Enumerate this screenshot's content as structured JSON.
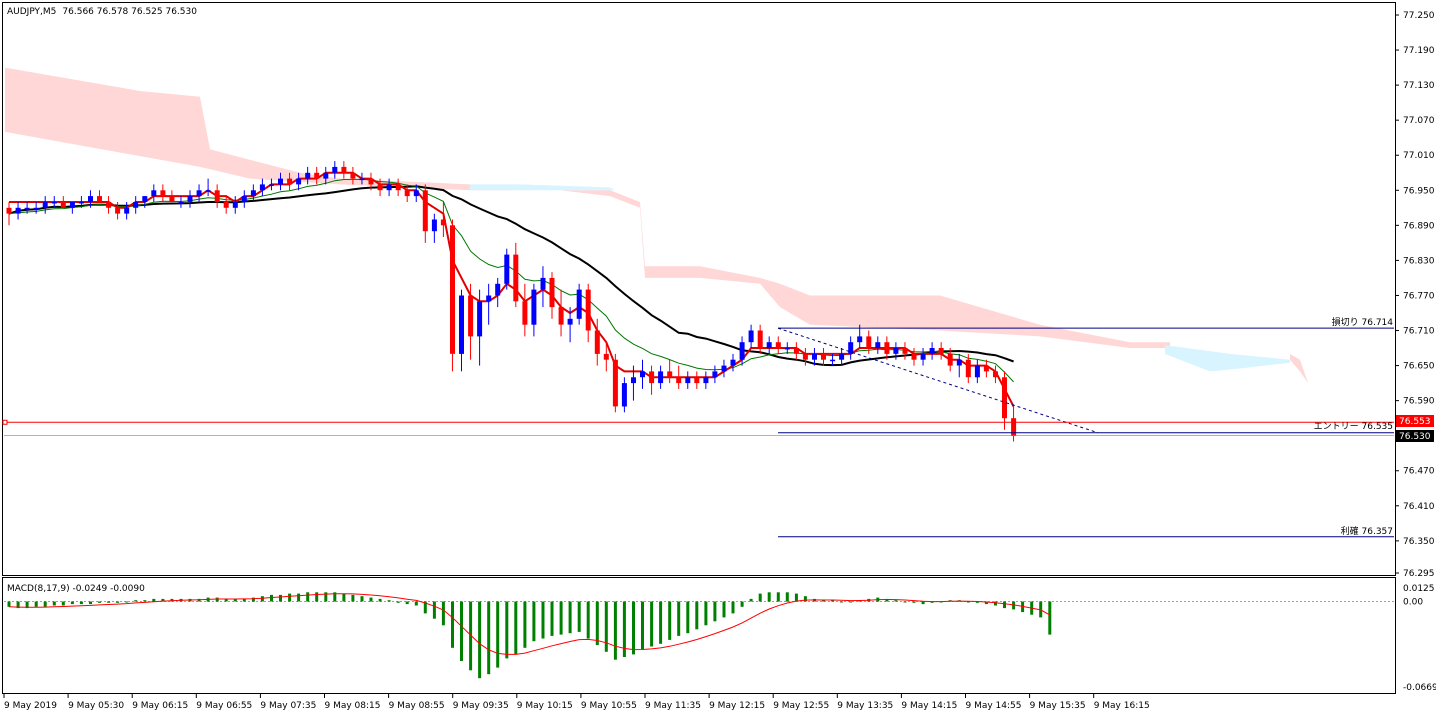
{
  "header": {
    "symbol": "AUDJPY,M5",
    "ohlc": "76.566 76.578 76.525 76.530"
  },
  "macd_panel": {
    "title": "MACD(8,17,9) -0.0249 -0.0090",
    "axis_labels": [
      "0.0125",
      "0.00",
      "-0.0669"
    ]
  },
  "price_axis": {
    "labels": [
      "77.250",
      "77.190",
      "77.130",
      "77.070",
      "77.010",
      "76.950",
      "76.890",
      "76.830",
      "76.770",
      "76.710",
      "76.650",
      "76.590",
      "76.530",
      "76.470",
      "76.410",
      "76.350",
      "76.295"
    ],
    "current_price": "76.530",
    "tag_553": "76.553"
  },
  "time_axis": {
    "labels": [
      "9 May 2019",
      "9 May 05:30",
      "9 May 06:15",
      "9 May 06:55",
      "9 May 07:35",
      "9 May 08:15",
      "9 May 08:55",
      "9 May 09:35",
      "9 May 10:15",
      "9 May 10:55",
      "9 May 11:35",
      "9 May 12:15",
      "9 May 12:55",
      "9 May 13:35",
      "9 May 14:15",
      "9 May 14:55",
      "9 May 15:35",
      "9 May 16:15"
    ]
  },
  "annotations": {
    "stop_loss": "損切り 76.714",
    "entry": "エントリー 76.535",
    "take_profit": "利確 76.357"
  },
  "colors": {
    "bull": "#0000ff",
    "bear": "#ff0000",
    "ema_fast": "#e00000",
    "ema_mid": "#007700",
    "sma_slow": "#000000",
    "cloud_red": "#ffd7d7",
    "cloud_blue": "#d7f4ff",
    "macd_hist": "#008000",
    "macd_signal": "#ff0000"
  },
  "chart_data": {
    "type": "candlestick",
    "ylim": [
      76.295,
      77.25
    ],
    "candles": [
      [
        76.92,
        76.93,
        76.89,
        76.91
      ],
      [
        76.91,
        76.93,
        76.9,
        76.92
      ],
      [
        76.92,
        76.93,
        76.91,
        76.92
      ],
      [
        76.92,
        76.93,
        76.91,
        76.92
      ],
      [
        76.92,
        76.94,
        76.91,
        76.93
      ],
      [
        76.93,
        76.94,
        76.92,
        76.93
      ],
      [
        76.93,
        76.94,
        76.92,
        76.92
      ],
      [
        76.92,
        76.93,
        76.91,
        76.93
      ],
      [
        76.93,
        76.94,
        76.92,
        76.93
      ],
      [
        76.93,
        76.95,
        76.92,
        76.94
      ],
      [
        76.94,
        76.95,
        76.93,
        76.93
      ],
      [
        76.93,
        76.94,
        76.91,
        76.92
      ],
      [
        76.92,
        76.93,
        76.9,
        76.91
      ],
      [
        76.91,
        76.93,
        76.9,
        76.92
      ],
      [
        76.92,
        76.94,
        76.91,
        76.93
      ],
      [
        76.93,
        76.94,
        76.92,
        76.94
      ],
      [
        76.94,
        76.96,
        76.93,
        76.95
      ],
      [
        76.95,
        76.96,
        76.93,
        76.94
      ],
      [
        76.94,
        76.95,
        76.93,
        76.93
      ],
      [
        76.93,
        76.94,
        76.92,
        76.93
      ],
      [
        76.93,
        76.95,
        76.92,
        76.94
      ],
      [
        76.94,
        76.96,
        76.93,
        76.95
      ],
      [
        76.95,
        76.97,
        76.94,
        76.95
      ],
      [
        76.95,
        76.96,
        76.92,
        76.93
      ],
      [
        76.93,
        76.94,
        76.91,
        76.92
      ],
      [
        76.92,
        76.94,
        76.91,
        76.93
      ],
      [
        76.93,
        76.95,
        76.92,
        76.94
      ],
      [
        76.94,
        76.96,
        76.93,
        76.95
      ],
      [
        76.95,
        76.97,
        76.94,
        76.96
      ],
      [
        76.96,
        76.97,
        76.95,
        76.96
      ],
      [
        76.96,
        76.98,
        76.95,
        76.97
      ],
      [
        76.97,
        76.98,
        76.95,
        76.96
      ],
      [
        76.96,
        76.98,
        76.95,
        76.97
      ],
      [
        76.97,
        76.99,
        76.96,
        76.98
      ],
      [
        76.98,
        76.99,
        76.96,
        76.97
      ],
      [
        76.97,
        76.99,
        76.96,
        76.98
      ],
      [
        76.98,
        77.0,
        76.97,
        76.99
      ],
      [
        76.99,
        77.0,
        76.97,
        76.98
      ],
      [
        76.98,
        76.99,
        76.96,
        76.97
      ],
      [
        76.97,
        76.98,
        76.96,
        76.97
      ],
      [
        76.97,
        76.98,
        76.95,
        76.96
      ],
      [
        76.96,
        76.97,
        76.94,
        76.95
      ],
      [
        76.95,
        76.97,
        76.94,
        76.96
      ],
      [
        76.96,
        76.97,
        76.94,
        76.95
      ],
      [
        76.95,
        76.96,
        76.93,
        76.94
      ],
      [
        76.94,
        76.96,
        76.93,
        76.95
      ],
      [
        76.95,
        76.96,
        76.86,
        76.88
      ],
      [
        76.88,
        76.91,
        76.86,
        76.9
      ],
      [
        76.9,
        76.93,
        76.87,
        76.89
      ],
      [
        76.89,
        76.9,
        76.64,
        76.67
      ],
      [
        76.67,
        76.78,
        76.64,
        76.77
      ],
      [
        76.77,
        76.79,
        76.66,
        76.7
      ],
      [
        76.7,
        76.78,
        76.65,
        76.76
      ],
      [
        76.76,
        76.79,
        76.72,
        76.77
      ],
      [
        76.77,
        76.8,
        76.75,
        76.79
      ],
      [
        76.79,
        76.85,
        76.78,
        76.84
      ],
      [
        76.84,
        76.86,
        76.75,
        76.76
      ],
      [
        76.76,
        76.79,
        76.7,
        76.72
      ],
      [
        76.72,
        76.79,
        76.7,
        76.78
      ],
      [
        76.78,
        76.82,
        76.75,
        76.8
      ],
      [
        76.8,
        76.81,
        76.73,
        76.75
      ],
      [
        76.75,
        76.78,
        76.7,
        76.72
      ],
      [
        76.72,
        76.75,
        76.69,
        76.73
      ],
      [
        76.73,
        76.79,
        76.72,
        76.78
      ],
      [
        76.78,
        76.79,
        76.69,
        76.71
      ],
      [
        76.71,
        76.73,
        76.65,
        76.67
      ],
      [
        76.67,
        76.69,
        76.64,
        76.66
      ],
      [
        76.66,
        76.67,
        76.57,
        76.58
      ],
      [
        76.58,
        76.63,
        76.57,
        76.62
      ],
      [
        76.62,
        76.65,
        76.59,
        76.63
      ],
      [
        76.63,
        76.66,
        76.61,
        76.64
      ],
      [
        76.64,
        76.65,
        76.6,
        76.62
      ],
      [
        76.62,
        76.65,
        76.61,
        76.64
      ],
      [
        76.64,
        76.66,
        76.62,
        76.63
      ],
      [
        76.63,
        76.65,
        76.61,
        76.62
      ],
      [
        76.62,
        76.64,
        76.61,
        76.63
      ],
      [
        76.63,
        76.64,
        76.61,
        76.62
      ],
      [
        76.62,
        76.64,
        76.61,
        76.63
      ],
      [
        76.63,
        76.65,
        76.62,
        76.64
      ],
      [
        76.64,
        76.66,
        76.63,
        76.65
      ],
      [
        76.65,
        76.67,
        76.64,
        76.66
      ],
      [
        76.66,
        76.7,
        76.65,
        76.69
      ],
      [
        76.69,
        76.72,
        76.68,
        76.71
      ],
      [
        76.71,
        76.72,
        76.67,
        76.68
      ],
      [
        76.68,
        76.7,
        76.67,
        76.69
      ],
      [
        76.69,
        76.7,
        76.67,
        76.68
      ],
      [
        76.68,
        76.69,
        76.67,
        76.68
      ],
      [
        76.68,
        76.69,
        76.66,
        76.67
      ],
      [
        76.67,
        76.68,
        76.65,
        76.66
      ],
      [
        76.66,
        76.68,
        76.65,
        76.67
      ],
      [
        76.67,
        76.68,
        76.65,
        76.66
      ],
      [
        76.66,
        76.67,
        76.65,
        76.66
      ],
      [
        76.66,
        76.68,
        76.65,
        76.67
      ],
      [
        76.67,
        76.7,
        76.66,
        76.69
      ],
      [
        76.69,
        76.72,
        76.68,
        76.7
      ],
      [
        76.7,
        76.71,
        76.67,
        76.68
      ],
      [
        76.68,
        76.7,
        76.67,
        76.69
      ],
      [
        76.69,
        76.7,
        76.66,
        76.67
      ],
      [
        76.67,
        76.69,
        76.66,
        76.68
      ],
      [
        76.68,
        76.69,
        76.66,
        76.67
      ],
      [
        76.67,
        76.68,
        76.65,
        76.66
      ],
      [
        76.66,
        76.68,
        76.65,
        76.67
      ],
      [
        76.67,
        76.69,
        76.66,
        76.68
      ],
      [
        76.68,
        76.69,
        76.66,
        76.67
      ],
      [
        76.67,
        76.68,
        76.64,
        76.65
      ],
      [
        76.65,
        76.67,
        76.63,
        76.66
      ],
      [
        76.66,
        76.67,
        76.62,
        76.63
      ],
      [
        76.63,
        76.66,
        76.62,
        76.65
      ],
      [
        76.65,
        76.66,
        76.63,
        76.64
      ],
      [
        76.64,
        76.65,
        76.62,
        76.63
      ],
      [
        76.63,
        76.64,
        76.54,
        76.56
      ],
      [
        76.56,
        76.58,
        76.52,
        76.53
      ]
    ],
    "ema_fast": [
      76.93,
      76.93,
      76.93,
      76.93,
      76.93,
      76.93,
      76.93,
      76.93,
      76.93,
      76.93,
      76.93,
      76.93,
      76.92,
      76.92,
      76.93,
      76.93,
      76.94,
      76.94,
      76.94,
      76.94,
      76.94,
      76.94,
      76.95,
      76.94,
      76.94,
      76.93,
      76.94,
      76.94,
      76.95,
      76.96,
      76.96,
      76.96,
      76.97,
      76.97,
      76.97,
      76.98,
      76.98,
      76.98,
      76.98,
      76.97,
      76.97,
      76.96,
      76.96,
      76.96,
      76.95,
      76.95,
      76.93,
      76.92,
      76.91,
      76.83,
      76.8,
      76.77,
      76.76,
      76.76,
      76.77,
      76.79,
      76.78,
      76.76,
      76.77,
      76.78,
      76.77,
      76.75,
      76.74,
      76.75,
      76.74,
      76.71,
      76.69,
      76.65,
      76.64,
      76.64,
      76.64,
      76.63,
      76.63,
      76.63,
      76.63,
      76.63,
      76.63,
      76.63,
      76.63,
      76.64,
      76.65,
      76.66,
      76.68,
      76.68,
      76.68,
      76.68,
      76.68,
      76.68,
      76.67,
      76.67,
      76.67,
      76.67,
      76.67,
      76.67,
      76.68,
      76.68,
      76.68,
      76.68,
      76.68,
      76.68,
      76.67,
      76.67,
      76.67,
      76.67,
      76.66,
      76.66,
      76.65,
      76.65,
      76.65,
      76.64,
      76.61,
      76.58
    ],
    "macd_hist": [
      -0.004,
      -0.005,
      -0.005,
      -0.004,
      -0.004,
      -0.003,
      -0.003,
      -0.002,
      -0.002,
      -0.002,
      -0.001,
      -0.001,
      -0.001,
      0.0,
      0.001,
      0.001,
      0.002,
      0.002,
      0.002,
      0.002,
      0.002,
      0.002,
      0.003,
      0.003,
      0.002,
      0.002,
      0.002,
      0.003,
      0.004,
      0.005,
      0.005,
      0.006,
      0.006,
      0.007,
      0.007,
      0.007,
      0.007,
      0.006,
      0.005,
      0.004,
      0.003,
      0.002,
      0.001,
      -0.001,
      -0.002,
      -0.003,
      -0.009,
      -0.013,
      -0.018,
      -0.035,
      -0.045,
      -0.052,
      -0.058,
      -0.055,
      -0.05,
      -0.043,
      -0.04,
      -0.035,
      -0.03,
      -0.028,
      -0.026,
      -0.025,
      -0.024,
      -0.023,
      -0.028,
      -0.033,
      -0.038,
      -0.044,
      -0.042,
      -0.04,
      -0.036,
      -0.034,
      -0.032,
      -0.029,
      -0.026,
      -0.024,
      -0.021,
      -0.018,
      -0.015,
      -0.012,
      -0.009,
      -0.004,
      0.002,
      0.006,
      0.007,
      0.007,
      0.007,
      0.006,
      0.004,
      0.002,
      0.001,
      0.001,
      0.0,
      0.0,
      0.001,
      0.002,
      0.003,
      0.002,
      0.001,
      0.0,
      -0.001,
      -0.002,
      -0.001,
      0.0,
      0.001,
      0.001,
      0.0,
      -0.001,
      -0.002,
      -0.003,
      -0.005,
      -0.006,
      -0.008,
      -0.01,
      -0.012,
      -0.025
    ]
  }
}
